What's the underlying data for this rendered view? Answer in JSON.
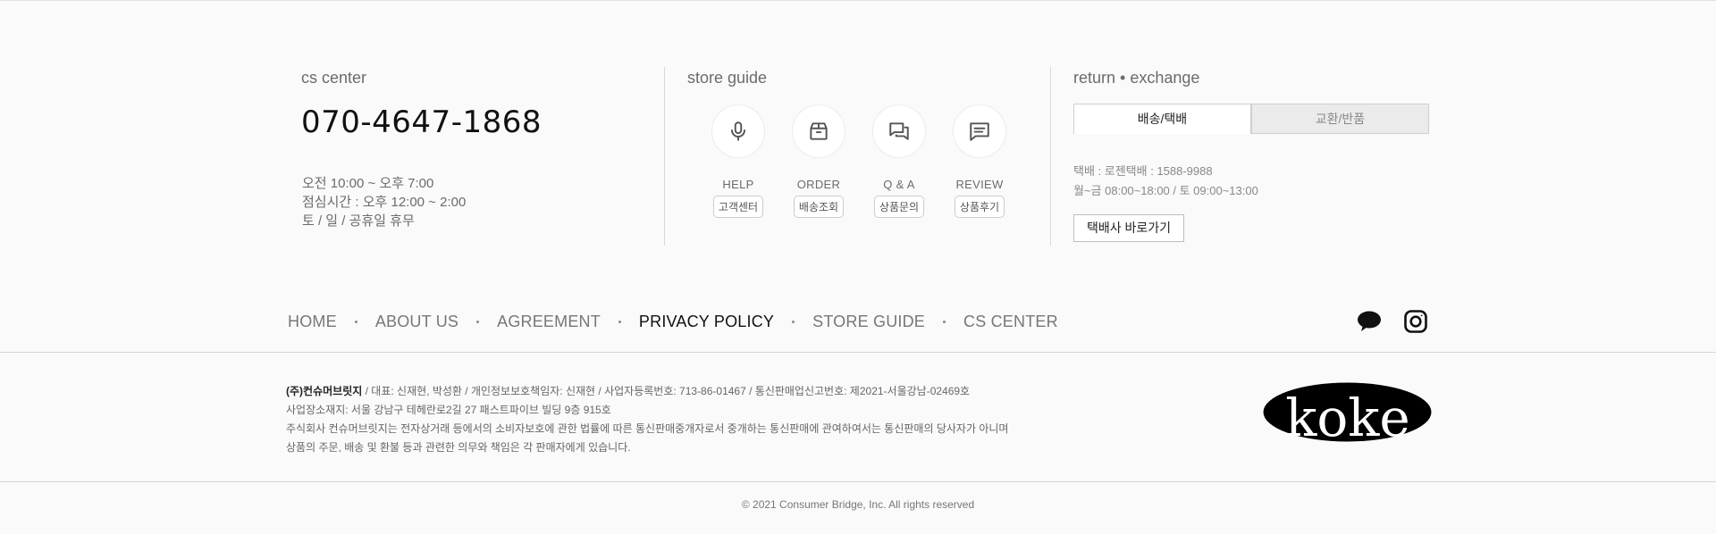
{
  "cs_center": {
    "title": "cs center",
    "phone": "070-4647-1868",
    "hours": [
      "오전 10:00 ~ 오후 7:00",
      "점심시간 : 오후 12:00 ~ 2:00",
      "토 / 일 / 공휴일 휴무"
    ]
  },
  "store_guide": {
    "title": "store guide",
    "items": [
      {
        "icon": "microphone-icon",
        "label": "HELP",
        "button": "고객센터"
      },
      {
        "icon": "box-icon",
        "label": "ORDER",
        "button": "배송조회"
      },
      {
        "icon": "chat-bubbles-icon",
        "label": "Q & A",
        "button": "상품문의"
      },
      {
        "icon": "message-icon",
        "label": "REVIEW",
        "button": "상품후기"
      }
    ]
  },
  "return_exchange": {
    "title": "return • exchange",
    "tabs": [
      "배송/택배",
      "교환/반품"
    ],
    "courier_lines": [
      "택배 : 로젠택배 : 1588-9988",
      "월~금 08:00~18:00 / 토 09:00~13:00"
    ],
    "courier_button": "택배사 바로가기"
  },
  "nav": {
    "items": [
      "HOME",
      "ABOUT US",
      "AGREEMENT",
      "PRIVACY POLICY",
      "STORE GUIDE",
      "CS CENTER"
    ],
    "current": "PRIVACY POLICY"
  },
  "social": {
    "icons": [
      "kakaotalk-icon",
      "instagram-icon"
    ]
  },
  "company": {
    "name": "(주)컨슈머브릿지",
    "line1_rest": " / 대표: 신재현, 박성환 / 개인정보보호책임자: 신재현 / 사업자등록번호: 713-86-01467 / 통신판매업신고번호: 제2021-서울강남-02469호",
    "line2": "사업장소재지: 서울 강남구 테헤란로2길 27 패스트파이브 빌딩 9층 915호",
    "line3": "주식회사 컨슈머브릿지는 전자상거래 등에서의 소비자보호에 관한 법률에 따른 통신판매중개자로서 중개하는 통신판매에 관여하여서는 통신판매의 당사자가 아니며",
    "line4": "상품의 주문, 배송 및 환불 등과 관련한 의무와 책임은 각 판매자에게 있습니다."
  },
  "logo_text": "koke",
  "copyright": "© 2021 Consumer Bridge, Inc. All rights reserved"
}
